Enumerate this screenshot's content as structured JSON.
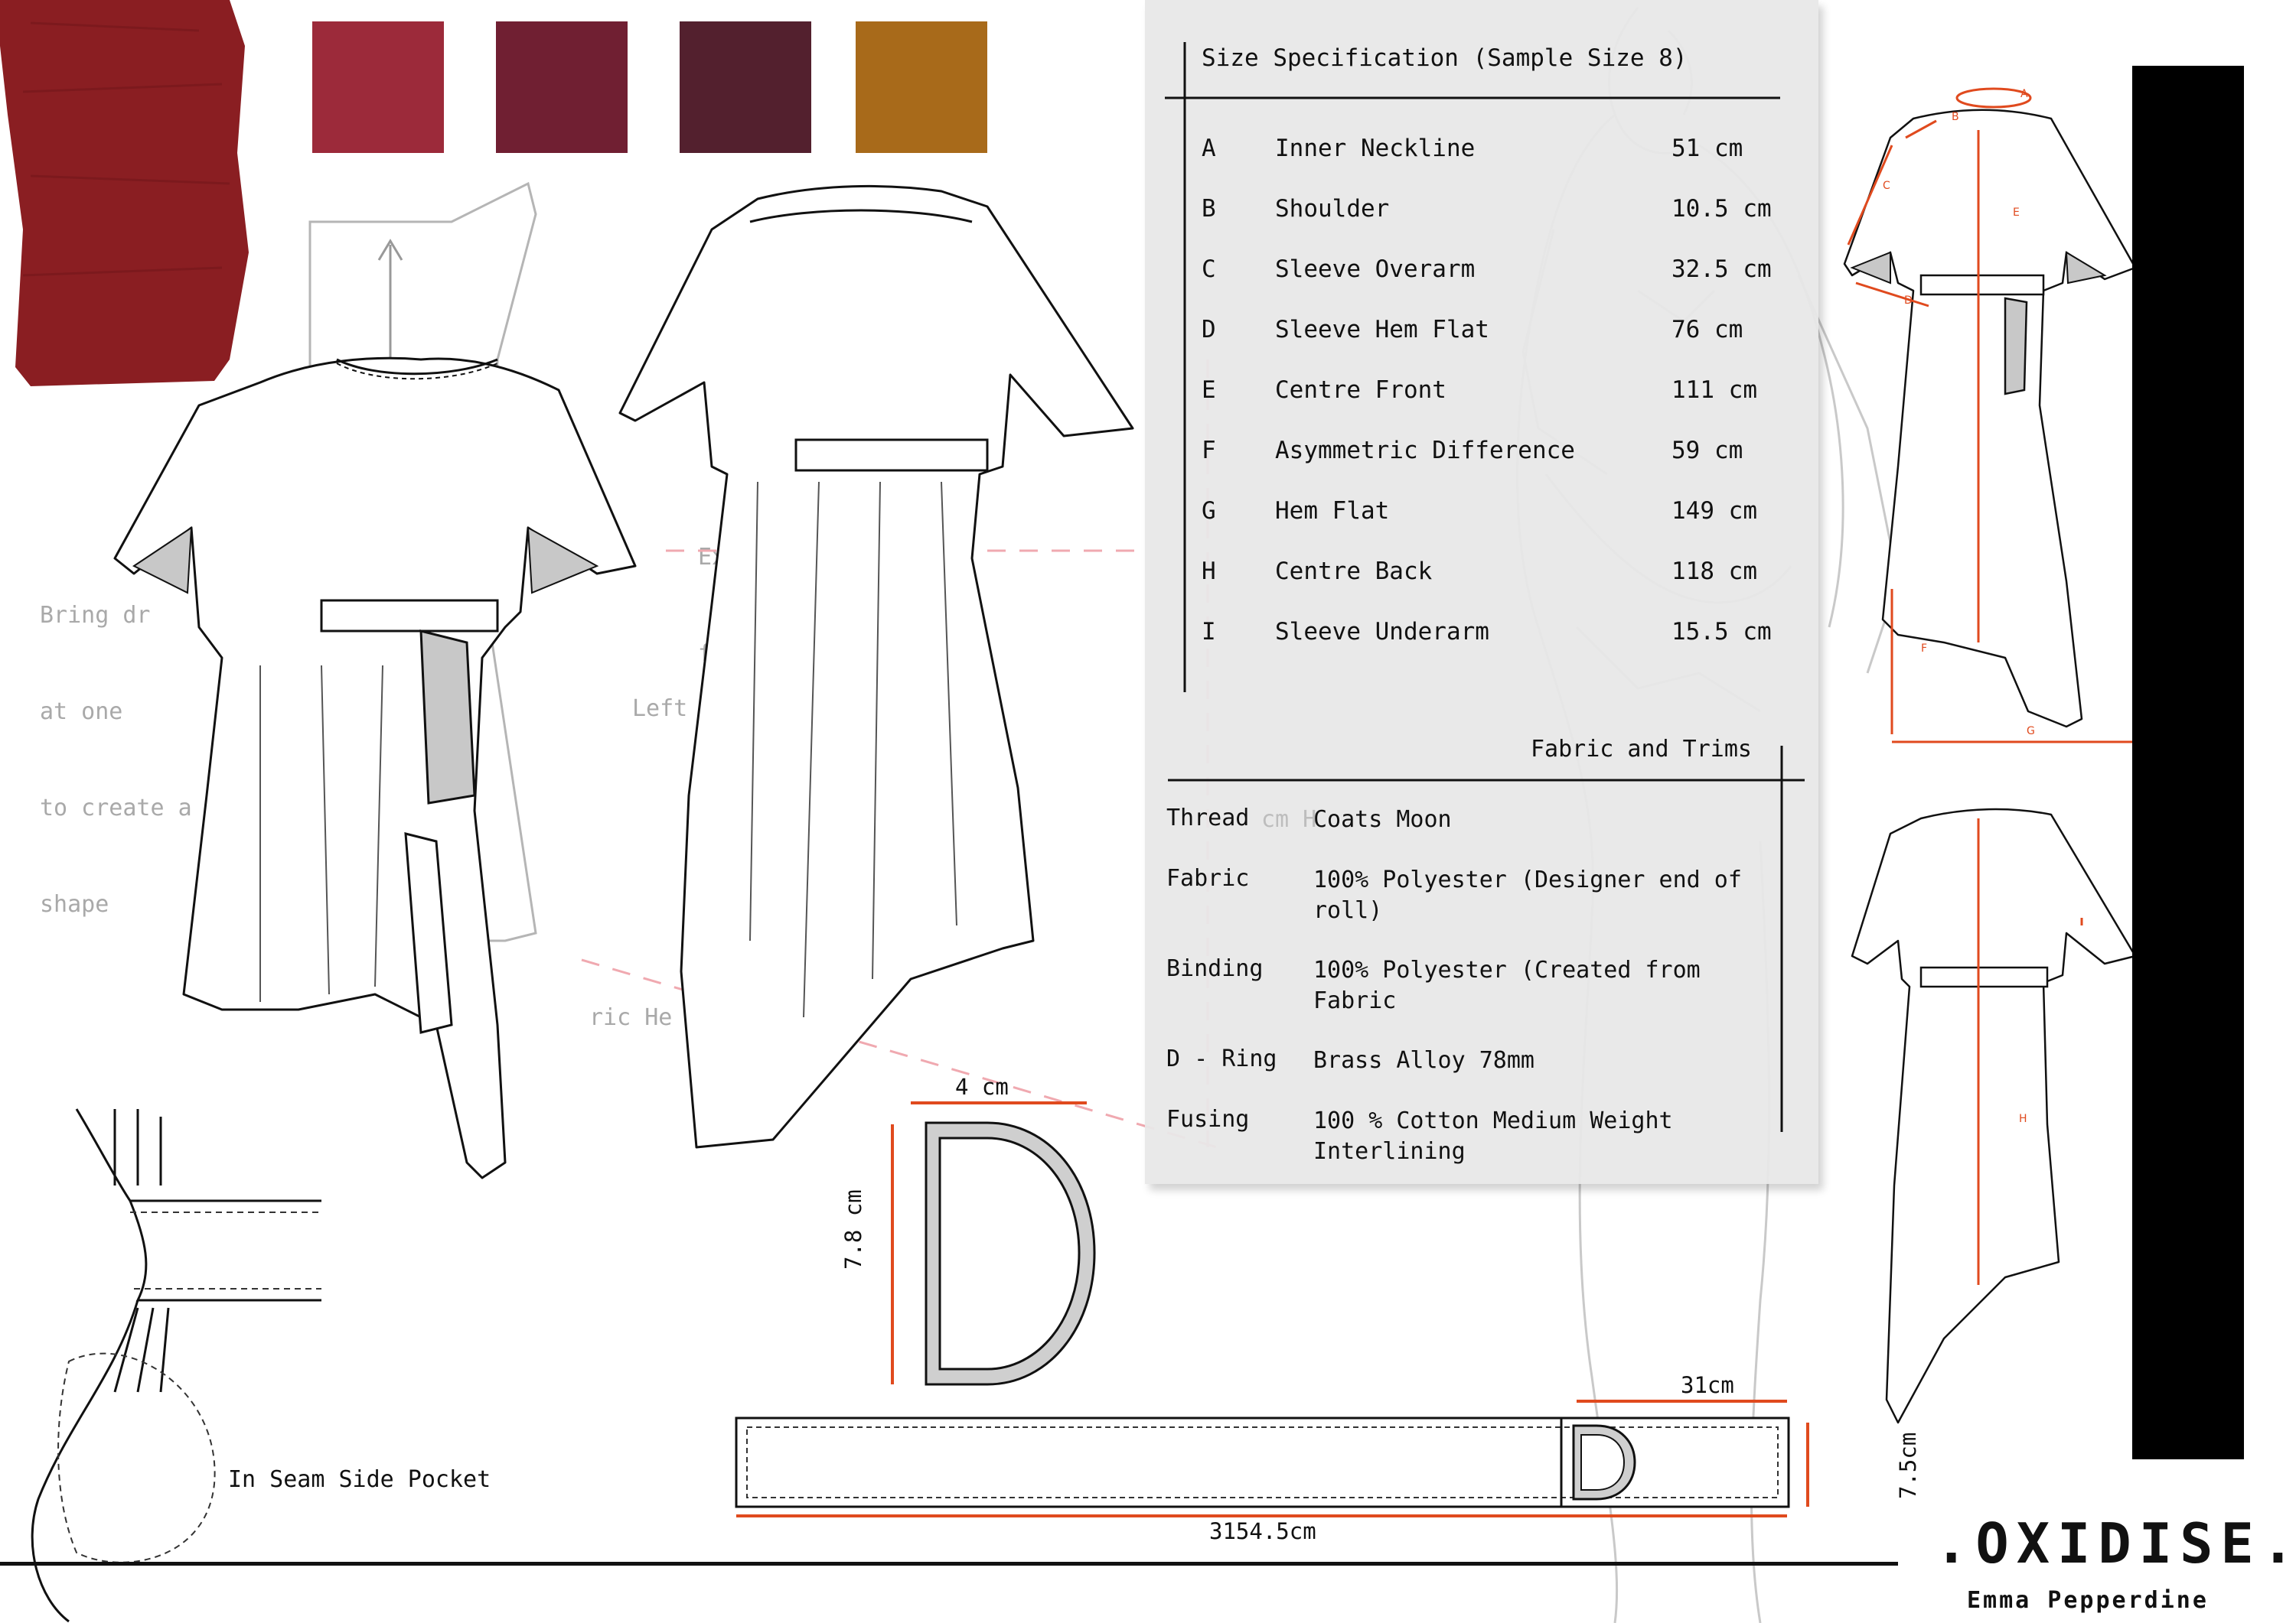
{
  "palette": [
    "#9c2a3a",
    "#701f32",
    "#53202e",
    "#a86a1a"
  ],
  "fabric_sample_color": "#8a1e22",
  "accent_color": "#e04a1e",
  "ghost_notes": {
    "bring": [
      "Bring dr",
      "at one",
      "to create a",
      "shape"
    ],
    "extend": [
      "Exten",
      "from"
    ],
    "left": "Left",
    "fabric_hem": "ric He",
    "cm_hem": "cm H"
  },
  "spec": {
    "title": "Size Specification (Sample Size 8)",
    "rows": [
      {
        "code": "A",
        "name": "Inner Neckline",
        "value": "51 cm"
      },
      {
        "code": "B",
        "name": "Shoulder",
        "value": "10.5 cm"
      },
      {
        "code": "C",
        "name": "Sleeve Overarm",
        "value": "32.5 cm"
      },
      {
        "code": "D",
        "name": "Sleeve Hem Flat",
        "value": "76 cm"
      },
      {
        "code": "E",
        "name": "Centre Front",
        "value": "111 cm"
      },
      {
        "code": "F",
        "name": "Asymmetric Difference",
        "value": "59 cm"
      },
      {
        "code": "G",
        "name": "Hem Flat",
        "value": "149 cm"
      },
      {
        "code": "H",
        "name": "Centre Back",
        "value": "118 cm"
      },
      {
        "code": "I",
        "name": "Sleeve Underarm",
        "value": "15.5 cm"
      }
    ]
  },
  "fabric": {
    "title": "Fabric and Trims",
    "rows": [
      {
        "label": "Thread",
        "value": "Coats Moon"
      },
      {
        "label": "Fabric",
        "value": "100% Polyester (Designer end of roll)"
      },
      {
        "label": "Binding",
        "value": "100% Polyester (Created from Fabric"
      },
      {
        "label": "D - Ring",
        "value": "Brass Alloy 78mm"
      },
      {
        "label": "Fusing",
        "value": "100 % Cotton Medium Weight Interlining"
      }
    ]
  },
  "dimensions": {
    "dring_width": "4 cm",
    "dring_height": "7.8 cm",
    "belt_end": "31cm",
    "belt_height": "7.5cm",
    "belt_length": "3154.5cm"
  },
  "measure_letters": [
    "A",
    "B",
    "C",
    "D",
    "E",
    "F",
    "G",
    "H"
  ],
  "pocket_label": "In Seam Side Pocket",
  "brand": {
    "title": ".OXIDISE.",
    "designer": "Emma Pepperdine"
  }
}
